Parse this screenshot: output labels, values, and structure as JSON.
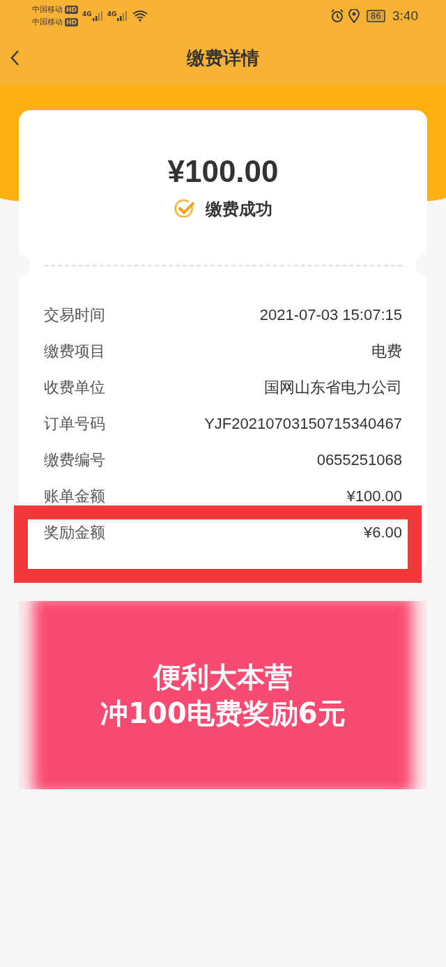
{
  "status_bar": {
    "carriers": [
      {
        "name": "中国移动",
        "badge": "HD",
        "network": "4G"
      },
      {
        "name": "中国移动",
        "badge": "HD",
        "network": "4G"
      }
    ],
    "battery": "86",
    "time": "3:40"
  },
  "header": {
    "title": "缴费详情"
  },
  "receipt": {
    "amount": "¥100.00",
    "status": "缴费成功",
    "rows": [
      {
        "label": "交易时间",
        "value": "2021-07-03 15:07:15",
        "highlighted": false
      },
      {
        "label": "缴费项目",
        "value": "电费",
        "highlighted": false
      },
      {
        "label": "收费单位",
        "value": "国网山东省电力公司",
        "highlighted": false
      },
      {
        "label": "订单号码",
        "value": "YJF20210703150715340467",
        "highlighted": false
      },
      {
        "label": "缴费编号",
        "value": "0655251068",
        "highlighted": false
      },
      {
        "label": "账单金额",
        "value": "¥100.00",
        "highlighted": false
      },
      {
        "label": "奖励金额",
        "value": "¥6.00",
        "highlighted": true
      }
    ]
  },
  "banner": {
    "lines": [
      "便利大本营",
      "冲100电费奖励6元"
    ]
  }
}
